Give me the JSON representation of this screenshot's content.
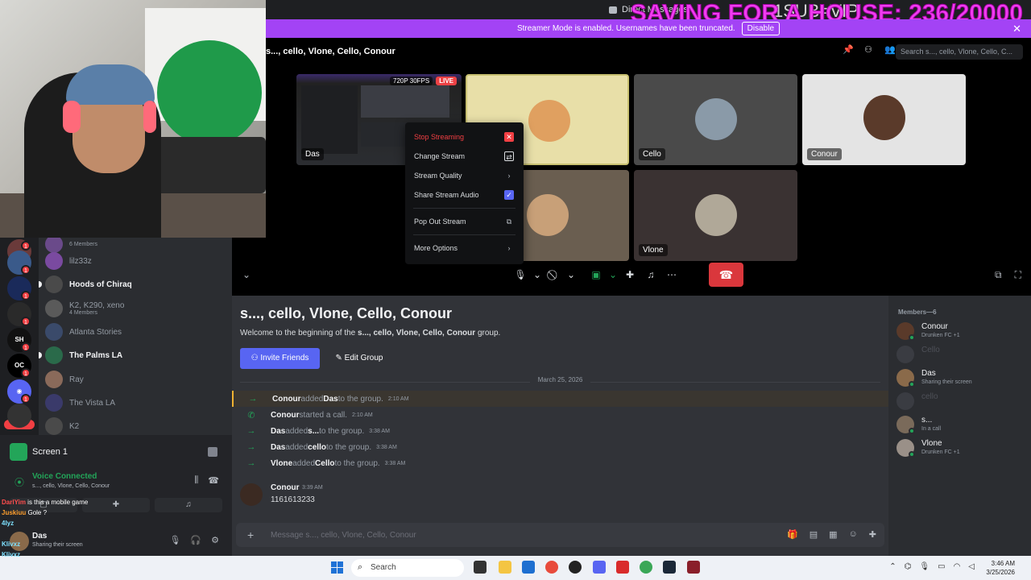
{
  "titlebar": {
    "title": "Direct Messages"
  },
  "overlay": {
    "goal_text": "SAVING FOR A HOUSE: 236/20000",
    "sub_text": "1SUB=VIP"
  },
  "banner": {
    "text": "Streamer Mode is enabled. Usernames have been truncated.",
    "disable_label": "Disable"
  },
  "call": {
    "title": "s..., cello, Vlone, Cello, Conour",
    "search_placeholder": "Search s..., cello, Vlone, Cello, C...",
    "stream_quality_badge": "720P 30FPS",
    "live_badge": "LIVE",
    "tiles": [
      {
        "label": "Das"
      },
      {
        "label": "Cello"
      },
      {
        "label": "Conour"
      },
      {
        "label": "Vlone"
      }
    ]
  },
  "context_menu": {
    "items": [
      {
        "label": "Stop Streaming"
      },
      {
        "label": "Change Stream"
      },
      {
        "label": "Stream Quality"
      },
      {
        "label": "Share Stream Audio"
      },
      {
        "label": "Pop Out Stream"
      },
      {
        "label": "More Options"
      }
    ]
  },
  "sidebar": {
    "dms": [
      {
        "name": "6 Members",
        "sub": ""
      },
      {
        "name": "lilz33z",
        "sub": ""
      },
      {
        "name": "Hoods of Chiraq",
        "sub": ""
      },
      {
        "name": "K2, K290, xeno",
        "sub": "4 Members"
      },
      {
        "name": "Atlanta Stories",
        "sub": ""
      },
      {
        "name": "The Palms LA",
        "sub": ""
      },
      {
        "name": "Ray",
        "sub": ""
      },
      {
        "name": "The Vista LA",
        "sub": ""
      },
      {
        "name": "K2",
        "sub": ""
      }
    ],
    "rail_new": "NEW"
  },
  "user_panel": {
    "screen_name": "Screen 1",
    "voice_title": "Voice Connected",
    "voice_sub": "s..., cello, Vlone, Cello, Conour",
    "user_name": "Das",
    "user_status": "Sharing their screen"
  },
  "chat_overlay": {
    "lines": [
      {
        "user": "DarlYim",
        "text": "is this a mobile game"
      },
      {
        "user": "Juskiuu",
        "text": "Gole ?"
      },
      {
        "user": "4lyz",
        "text": ""
      },
      {
        "user": "Klivxz",
        "text": ""
      },
      {
        "user": "Klivxz",
        "text": ""
      }
    ]
  },
  "main": {
    "channel_title": "s..., cello, Vlone, Cello, Conour",
    "welcome_prefix": "Welcome to the beginning of the ",
    "welcome_names": "s..., cello, Vlone, Cello, Conour",
    "welcome_suffix": " group.",
    "invite_label": "Invite Friends",
    "edit_label": "Edit Group",
    "date_divider": "March 25, 2026",
    "system_messages": [
      {
        "actor": "Conour",
        "verb": " added ",
        "target": "Das",
        "end": " to the group.",
        "time": "2:10 AM"
      },
      {
        "actor": "Conour",
        "verb": " started a call.",
        "target": "",
        "end": "",
        "time": "2:10 AM"
      },
      {
        "actor": "Das",
        "verb": " added ",
        "target": "s...",
        "end": " to the group.",
        "time": "3:38 AM"
      },
      {
        "actor": "Das",
        "verb": " added ",
        "target": "cello",
        "end": " to the group.",
        "time": "3:38 AM"
      },
      {
        "actor": "Vlone",
        "verb": " added ",
        "target": "Cello",
        "end": " to the group.",
        "time": "3:38 AM"
      }
    ],
    "message": {
      "author": "Conour",
      "time": "3:39 AM",
      "text": "1161613233"
    },
    "composer_placeholder": "Message s..., cello, Vlone, Cello, Conour"
  },
  "members": {
    "header": "Members—6",
    "list": [
      {
        "name": "Conour",
        "sub": "Drunken FC +1",
        "dim": false
      },
      {
        "name": "Cello",
        "sub": "",
        "dim": true
      },
      {
        "name": "Das",
        "sub": "Sharing their screen",
        "dim": false
      },
      {
        "name": "cello",
        "sub": "",
        "dim": true
      },
      {
        "name": "s...",
        "sub": "In a call",
        "dim": false
      },
      {
        "name": "Vlone",
        "sub": "Drunken FC +1",
        "dim": false
      }
    ]
  },
  "taskbar": {
    "search_label": "Search",
    "time": "3:46 AM",
    "date": "3/25/2026"
  },
  "colors": {
    "accent": "#5865f2",
    "banner": "#a343f5",
    "danger": "#da373c",
    "online": "#23a559"
  }
}
